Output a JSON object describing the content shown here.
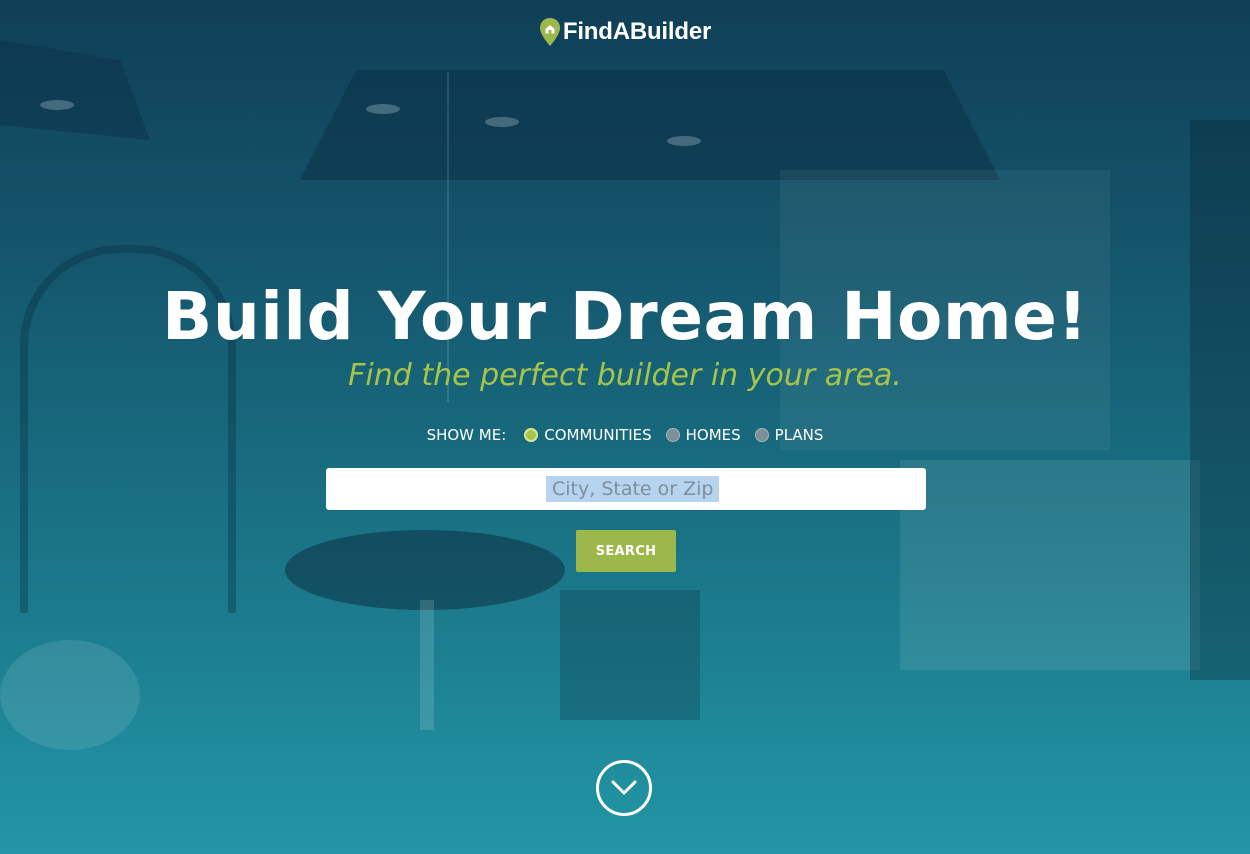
{
  "brand": {
    "logo_text": "FindABuilder",
    "icon": "map-pin-house-icon",
    "accent_color": "#a7c44a"
  },
  "hero": {
    "headline": "Build Your Dream Home!",
    "subheadline": "Find the perfect builder in your area."
  },
  "search": {
    "show_me_label": "SHOW ME:",
    "options": [
      {
        "label": "COMMUNITIES",
        "checked": true
      },
      {
        "label": "HOMES",
        "checked": false
      },
      {
        "label": "PLANS",
        "checked": false
      }
    ],
    "placeholder": "City, State or Zip",
    "value": "",
    "button_label": "SEARCH"
  },
  "scroll": {
    "icon": "chevron-down-circle-icon"
  },
  "colors": {
    "button": "#9db84a",
    "background_top": "#0f3f57",
    "background_bottom": "#2296a6"
  }
}
